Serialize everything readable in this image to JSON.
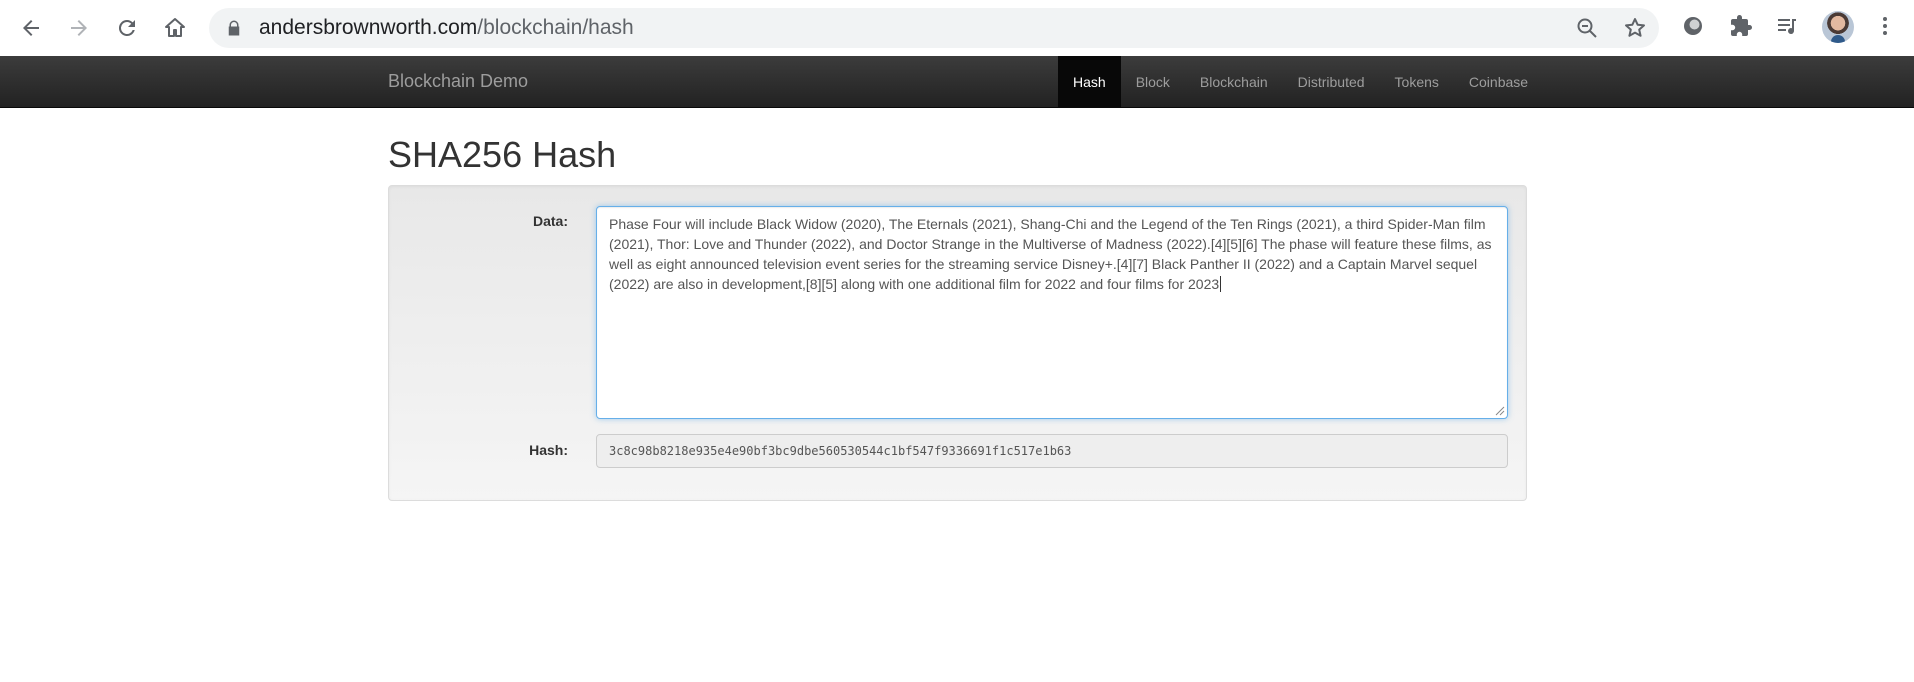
{
  "browser": {
    "url_domain": "andersbrownworth.com",
    "url_path": "/blockchain/hash",
    "icons": [
      "back-icon",
      "forward-icon",
      "reload-icon",
      "home-icon",
      "lock-icon",
      "zoom-out-icon",
      "bookmark-star-icon",
      "extension-circle-icon",
      "extensions-puzzle-icon",
      "media-queue-icon",
      "avatar",
      "more-vert-icon"
    ]
  },
  "navbar": {
    "brand": "Blockchain Demo",
    "items": [
      {
        "label": "Hash",
        "active": true
      },
      {
        "label": "Block"
      },
      {
        "label": "Blockchain"
      },
      {
        "label": "Distributed"
      },
      {
        "label": "Tokens"
      },
      {
        "label": "Coinbase"
      }
    ]
  },
  "page": {
    "title": "SHA256 Hash",
    "data_label": "Data:",
    "data_value": "Phase Four will include Black Widow (2020), The Eternals (2021), Shang-Chi and the Legend of the Ten Rings (2021), a third Spider-Man film (2021), Thor: Love and Thunder (2022), and Doctor Strange in the Multiverse of Madness (2022).[4][5][6] The phase will feature these films, as well as eight announced television event series for the streaming service Disney+.[4][7] Black Panther II (2022) and a Captain Marvel sequel (2022) are also in development,[8][5] along with one additional film for 2022 and four films for 2023",
    "hash_label": "Hash:",
    "hash_value": "3c8c98b8218e935e4e90bf3bc9dbe560530544c1bf547f9336691f1c517e1b63"
  },
  "colors": {
    "navbar": "#222222",
    "active_nav": "#080808",
    "focus_border": "#66afe9"
  }
}
